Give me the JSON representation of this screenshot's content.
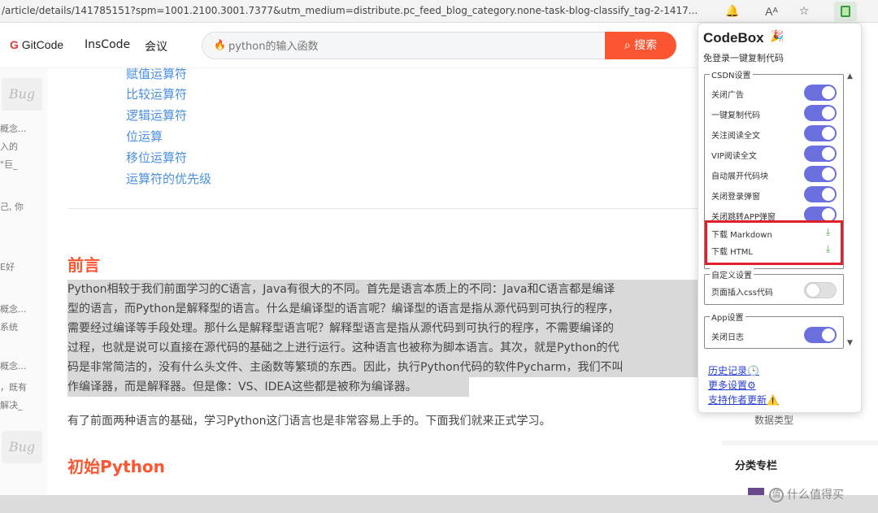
{
  "browser": {
    "url": "/article/details/141785151?spm=1001.2100.3001.7377&utm_medium=distribute.pc_feed_blog_category.none-task-blog-classify_tag-2-1417...",
    "icons": [
      "bell-icon",
      "read-aloud-icon",
      "favorite-star-icon",
      "codebox-extension-icon"
    ]
  },
  "header": {
    "logo_text": "GitCode",
    "nav": [
      "InsCode",
      "会议"
    ],
    "search_placeholder": "python的输入函数",
    "search_button": "搜索"
  },
  "left_gutter": {
    "card_label": "Bug",
    "snippets": [
      "概念...",
      "入的",
      "\"巨_",
      "己, 你",
      "E好",
      "概念...",
      "系统",
      "概念...",
      "，既有",
      "解决_"
    ]
  },
  "article": {
    "toc": [
      "赋值运算符",
      "比较运算符",
      "逻辑运算符",
      "位运算",
      "移位运算符",
      "运算符的优先级"
    ],
    "heading1": "前言",
    "highlighted_lines": [
      "Python相较于我们前面学习的C语言，Java有很大的不同。首先是语言本质上的不同：Java和C语言都是编译",
      "型的语言，而Python是解释型的语言。什么是编译型的语言呢？编译型的语言是指从源代码到可执行的程序，",
      "需要经过编译等手段处理。那什么是解释型语言呢？解释型语言是指从源代码到可执行的程序，不需要编译的",
      "过程，也就是说可以直接在源代码的基础之上进行运行。这种语言也被称为脚本语言。其次，就是Python的代",
      "码是非常简洁的，没有什么头文件、主函数等繁琐的东西。因此，执行Python代码的软件Pycharm，我们不叫",
      "作编译器，而是解释器。但是像：VS、IDEA这些都是被称为编译器。"
    ],
    "paragraph": "有了前面两种语言的基础，学习Python这门语言也是非常容易上手的。下面我们就来正式学习。",
    "heading2": "初始Python"
  },
  "right_column": {
    "item": "数据类型",
    "section_title": "分类专栏",
    "watermark": "什么值得买"
  },
  "popup": {
    "title": "CodeBox",
    "subtitle": "免登录一键复制代码",
    "csdn_group": {
      "legend": "CSDN设置",
      "options": [
        {
          "label": "关闭广告",
          "on": true
        },
        {
          "label": "一键复制代码",
          "on": true
        },
        {
          "label": "关注阅读全文",
          "on": true
        },
        {
          "label": "VIP阅读全文",
          "on": true
        },
        {
          "label": "自动展开代码块",
          "on": true
        },
        {
          "label": "关闭登录弹窗",
          "on": true
        },
        {
          "label": "关闭跳转APP弹窗",
          "on": true
        }
      ],
      "downloads": [
        {
          "label": "下载 Markdown",
          "icon": "download-icon"
        },
        {
          "label": "下载 HTML",
          "icon": "download-icon"
        }
      ]
    },
    "custom_group": {
      "legend": "自定义设置",
      "options": [
        {
          "label": "页面插入css代码",
          "on": false
        }
      ]
    },
    "app_group": {
      "legend": "App设置",
      "options": [
        {
          "label": "关闭日志",
          "on": true
        }
      ]
    },
    "links": [
      "历史记录🕒",
      "更多设置⚙",
      "支持作者更新⚠️"
    ],
    "colors": {
      "toggle_on": "#6b6fe0",
      "highlight_border": "#e0202a",
      "link": "#2a3fd6"
    }
  }
}
